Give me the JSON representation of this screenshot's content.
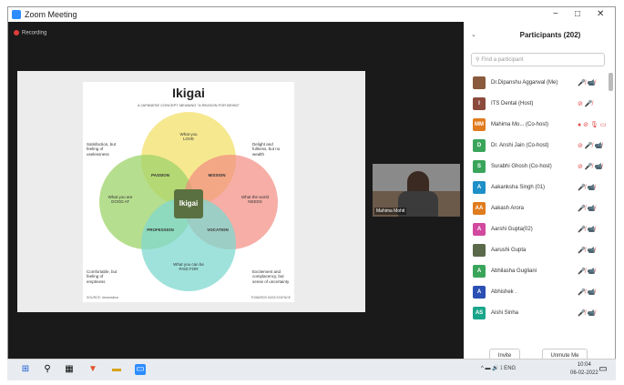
{
  "window": {
    "title": "Zoom Meeting",
    "minimize": "−",
    "maximize": "□",
    "close": "✕"
  },
  "recording": {
    "label": "Recording"
  },
  "slide": {
    "title": "Ikigai",
    "subtitle": "A JAPANESE CONCEPT MEANING \"A REASON FOR BEING\"",
    "circles": {
      "love": "What you LOVE",
      "good_at": "What you are GOOD AT",
      "world_needs": "What the world NEEDS",
      "paid_for": "What you can be PAID FOR"
    },
    "overlaps": {
      "passion": "PASSION",
      "mission": "MISSION",
      "profession": "PROFESSION",
      "vocation": "VOCATION",
      "center": "Ikigai"
    },
    "notes": {
      "top_left": "Satisfaction, but feeling of uselessness",
      "top_right": "Delight and fullness, but no wealth",
      "bottom_left": "Comfortable, but feeling of emptiness",
      "bottom_right": "Excitement and complacency, but sense of uncertainty"
    },
    "source_left": "SOURCE: dreamstime",
    "source_right": "TOWARDS DATA SCIENCE"
  },
  "video": {
    "name": "Mahima Mohit"
  },
  "panel": {
    "title": "Participants (202)",
    "search_placeholder": "Find a participant",
    "participants": [
      {
        "name": "Dr.Dipanshu Aggarwal (Me)",
        "avatar": "",
        "color": "#8a5a3c",
        "icons": "🎤̸ 📹̸"
      },
      {
        "name": "ITS Dental (Host)",
        "avatar": "I",
        "color": "#8b4a3c",
        "icons": "⊘ 🎤̸"
      },
      {
        "name": "Mahima Mo... (Co-host)",
        "avatar": "MM",
        "color": "#e07b1e",
        "icons": "● ⊘ 🎙 ▭"
      },
      {
        "name": "Dr. Anshi Jain (Co-host)",
        "avatar": "D",
        "color": "#3aa55a",
        "icons": "⊘ 🎤̸ 📹̸"
      },
      {
        "name": "Surabhi Ghosh (Co-host)",
        "avatar": "S",
        "color": "#3aa55a",
        "icons": "⊘ 🎤̸ 📹̸"
      },
      {
        "name": "Aakanksha Singh (01)",
        "avatar": "A",
        "color": "#1e8fc7",
        "icons": "🎤̸ 📹̸"
      },
      {
        "name": "Aakash Arora",
        "avatar": "AA",
        "color": "#e07b1e",
        "icons": "🎤̸ 📹̸"
      },
      {
        "name": "Aarshi Gupta(02)",
        "avatar": "A",
        "color": "#d24aa0",
        "icons": "🎤̸ 📹̸"
      },
      {
        "name": "Aarushi Gupta",
        "avatar": "",
        "color": "#5a6a4a",
        "icons": "🎤̸ 📹̸"
      },
      {
        "name": "Abhilasha Gugliani",
        "avatar": "A",
        "color": "#3aa55a",
        "icons": "🎤̸ 📹̸"
      },
      {
        "name": "Abhishek .",
        "avatar": "A",
        "color": "#2b4fb3",
        "icons": "🎤̸ 📹̸"
      },
      {
        "name": "Aishi Sinha",
        "avatar": "AS",
        "color": "#1aa58a",
        "icons": "🎤̸ 📹̸"
      }
    ],
    "invite_label": "Invite",
    "unmute_label": "Unmute Me"
  },
  "taskbar": {
    "tray": "^  ▬  🔊  ⟟  ENG",
    "time": "10:04",
    "date": "06-02-2022"
  }
}
